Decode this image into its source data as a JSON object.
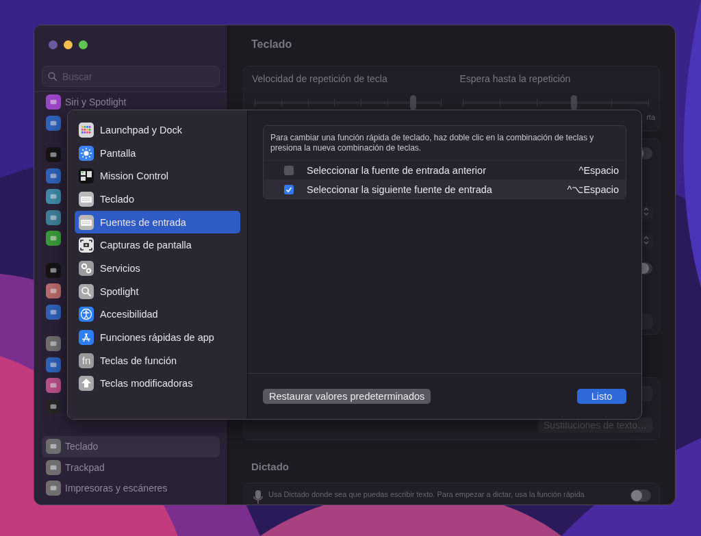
{
  "window": {
    "traffic_lights": [
      {
        "color": "#6b5a9e"
      },
      {
        "color": "#f2bd4c"
      },
      {
        "color": "#5ec553"
      }
    ]
  },
  "sidebar": {
    "search": {
      "placeholder": "Buscar"
    },
    "groups": [
      [
        {
          "label": "Siri y Spotlight",
          "color": "#9a46c4",
          "selected": false
        },
        {
          "color": "#2f62b8",
          "selected": false
        }
      ],
      [
        {
          "color": "#151515",
          "selected": false
        },
        {
          "color": "#2f62b8",
          "selected": false
        },
        {
          "color": "#3f8aa6",
          "selected": false
        },
        {
          "color": "#3f7f9a",
          "selected": false
        },
        {
          "color": "#3a9a3a",
          "selected": false
        }
      ],
      [
        {
          "color": "#141414",
          "selected": false
        },
        {
          "color": "#b86a6a",
          "selected": false
        },
        {
          "color": "#2f62b8",
          "selected": false
        }
      ],
      [
        {
          "color": "#6e6e6e",
          "selected": false
        },
        {
          "color": "#2f62b8",
          "selected": false
        },
        {
          "color": "#b8508a",
          "selected": false
        },
        {
          "color": "#262626",
          "selected": false
        }
      ],
      [
        {
          "label": "Teclado",
          "color": "#6e6e6e",
          "selected": true
        },
        {
          "label": "Trackpad",
          "color": "#6e6e6e",
          "selected": false
        },
        {
          "label": "Impresoras y escáneres",
          "color": "#6e6e6e",
          "selected": false
        }
      ]
    ]
  },
  "content": {
    "title": "Teclado",
    "sliders": [
      {
        "label": "Velocidad de repetición de tecla",
        "level": 0.85
      },
      {
        "label": "Espera hasta la repetición",
        "level": 0.6,
        "end_caption": "rta"
      }
    ],
    "controls": [
      {
        "kind": "toggle",
        "on": false
      },
      {
        "kind": "stepper"
      },
      {
        "kind": "stepper"
      },
      {
        "kind": "toggle",
        "on": false
      },
      {
        "kind": "button"
      }
    ],
    "text_group": {
      "controls": [
        {
          "kind": "button"
        }
      ],
      "button": "Sustituciones de texto…"
    },
    "dictation": {
      "heading": "Dictado",
      "description": "Usa Dictado donde sea que puedas escribir texto. Para empezar a dictar, usa la función rápida",
      "on": false
    }
  },
  "sheet": {
    "categories": [
      {
        "label": "Launchpad y Dock",
        "selected": false
      },
      {
        "label": "Pantalla",
        "selected": false
      },
      {
        "label": "Mission Control",
        "selected": false
      },
      {
        "label": "Teclado",
        "selected": false
      },
      {
        "label": "Fuentes de entrada",
        "selected": true
      },
      {
        "label": "Capturas de pantalla",
        "selected": false
      },
      {
        "label": "Servicios",
        "selected": false
      },
      {
        "label": "Spotlight",
        "selected": false
      },
      {
        "label": "Accesibilidad",
        "selected": false
      },
      {
        "label": "Funciones rápidas de app",
        "selected": false
      },
      {
        "label": "Teclas de función",
        "selected": false,
        "icon_text": "fn"
      },
      {
        "label": "Teclas modificadoras",
        "selected": false
      }
    ],
    "hint": "Para cambiar una función rápida de teclado, haz doble clic en la combinación de teclas y presiona la nueva combinación de teclas.",
    "shortcuts": [
      {
        "label": "Seleccionar la fuente de entrada anterior",
        "checked": false,
        "keys": "^Espacio"
      },
      {
        "label": "Seleccionar la siguiente fuente de entrada",
        "checked": true,
        "keys": "^⌥Espacio"
      }
    ],
    "restore_button": "Restaurar valores predeterminados",
    "done_button": "Listo"
  }
}
